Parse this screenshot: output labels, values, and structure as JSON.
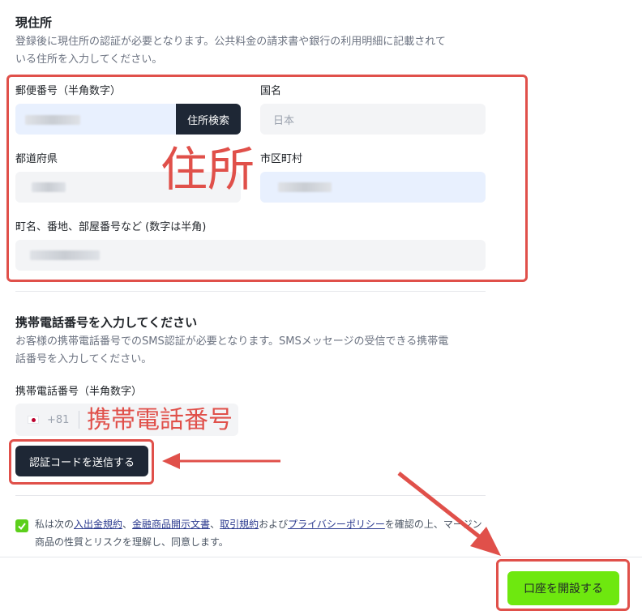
{
  "address": {
    "title": "現住所",
    "description_line1": "登録後に現住所の認証が必要となります。公共料金の請求書や銀行の利用明細に記載されて",
    "description_line2": "いる住所を入力してください。",
    "postal_label": "郵便番号（半角数字）",
    "search_button": "住所検索",
    "country_label": "国名",
    "country_value": "日本",
    "prefecture_label": "都道府県",
    "city_label": "市区町村",
    "street_label": "町名、番地、部屋番号など (数字は半角)"
  },
  "phone": {
    "title": "携帯電話番号を入力してください",
    "description_line1": "お客様の携帯電話番号でのSMS認証が必要となります。SMSメッセージの受信できる携帯電",
    "description_line2": "話番号を入力してください。",
    "field_label": "携帯電話番号（半角数字）",
    "country_code": "+81",
    "send_code_button": "認証コードを送信する"
  },
  "agreement": {
    "prefix": "私は次の",
    "link1": "入出金規約",
    "sep1": "、",
    "link2": "金融商品開示文書",
    "sep2": "、",
    "link3": "取引規約",
    "sep3": "および",
    "link4": "プライバシーポリシー",
    "suffix_line1": "を確認の上、マージン",
    "line2": "商品の性質とリスクを理解し、同意します。",
    "checked": true
  },
  "footer": {
    "open_account_button": "口座を開設する"
  },
  "annotations": {
    "address_label": "住所",
    "phone_label": "携帯電話番号"
  },
  "colors": {
    "annotation_red": "#e0504a",
    "primary_green": "#6ee80f",
    "dark_button": "#1e2735"
  }
}
